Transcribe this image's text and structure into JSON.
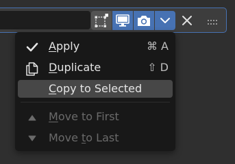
{
  "header": {
    "name_value": "",
    "buttons": [
      {
        "icon": "edit-mode-icon",
        "active": false
      },
      {
        "icon": "monitor-icon",
        "active": true
      },
      {
        "icon": "camera-icon",
        "active": true
      },
      {
        "icon": "chevron-down-icon",
        "active": true
      }
    ],
    "close_icon": "close-icon",
    "drag_icon": "drag-handle-icon"
  },
  "menu": {
    "items": [
      {
        "label_pre": "",
        "label_ul": "A",
        "label_post": "pply",
        "shortcut": "⌘ A",
        "icon": "checkmark-icon",
        "enabled": true,
        "highlighted": false
      },
      {
        "label_pre": "",
        "label_ul": "D",
        "label_post": "uplicate",
        "shortcut": "⇧ D",
        "icon": "duplicate-icon",
        "enabled": true,
        "highlighted": false
      },
      {
        "label_pre": "",
        "label_ul": "C",
        "label_post": "opy to Selected",
        "shortcut": "",
        "icon": "",
        "enabled": true,
        "highlighted": true
      },
      {
        "label_pre": "",
        "label_ul": "M",
        "label_post": "ove to First",
        "shortcut": "",
        "icon": "triangle-up-icon",
        "enabled": false,
        "highlighted": false
      },
      {
        "label_pre": "Move ",
        "label_ul": "t",
        "label_post": "o Last",
        "shortcut": "",
        "icon": "triangle-down-icon",
        "enabled": false,
        "highlighted": false
      }
    ]
  },
  "colors": {
    "accent": "#4772b3",
    "menu_bg": "#181818",
    "highlight": "#474747",
    "text": "#e5e5e5",
    "disabled_text": "#6a6a6a"
  }
}
